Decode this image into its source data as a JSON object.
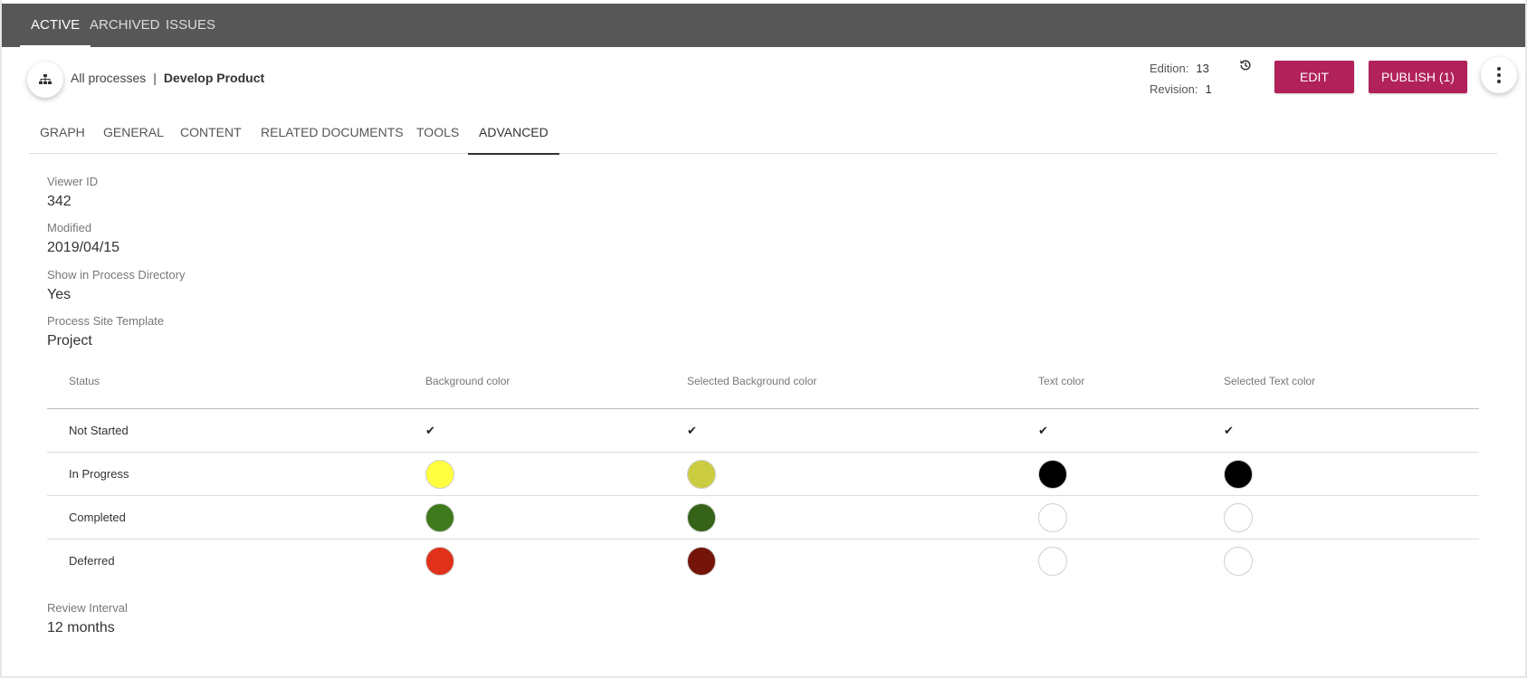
{
  "top_tabs": [
    "ACTIVE",
    "ARCHIVED",
    "ISSUES"
  ],
  "breadcrumb": {
    "root": "All processes",
    "separator": "|",
    "current": "Develop Product"
  },
  "meta": {
    "edition_label": "Edition:",
    "edition_value": "13",
    "revision_label": "Revision:",
    "revision_value": "1"
  },
  "buttons": {
    "edit": "EDIT",
    "publish": "PUBLISH (1)"
  },
  "sub_tabs": [
    "GRAPH",
    "GENERAL",
    "CONTENT",
    "RELATED DOCUMENTS",
    "TOOLS",
    "ADVANCED"
  ],
  "fields": {
    "viewer_id": {
      "label": "Viewer ID",
      "value": "342"
    },
    "modified": {
      "label": "Modified",
      "value": "2019/04/15"
    },
    "show_in_directory": {
      "label": "Show in Process Directory",
      "value": "Yes"
    },
    "site_template": {
      "label": "Process Site Template",
      "value": "Project"
    },
    "review_interval": {
      "label": "Review Interval",
      "value": "12 months"
    }
  },
  "status_table": {
    "headers": [
      "Status",
      "Background color",
      "Selected Background color",
      "Text color",
      "Selected Text color"
    ],
    "check_glyph": "✔",
    "rows": [
      {
        "status": "Not Started",
        "background": null,
        "selected_background": null,
        "text": null,
        "selected_text": null
      },
      {
        "status": "In Progress",
        "background": "#ffff40",
        "selected_background": "#cccc40",
        "text": "#000000",
        "selected_text": "#000000"
      },
      {
        "status": "Completed",
        "background": "#3f7a1e",
        "selected_background": "#356318",
        "text": "#ffffff",
        "selected_text": "#ffffff"
      },
      {
        "status": "Deferred",
        "background": "#e0321a",
        "selected_background": "#751509",
        "text": "#ffffff",
        "selected_text": "#ffffff"
      }
    ]
  },
  "colors": {
    "topbar": "#575757",
    "accent": "#b1215a"
  }
}
